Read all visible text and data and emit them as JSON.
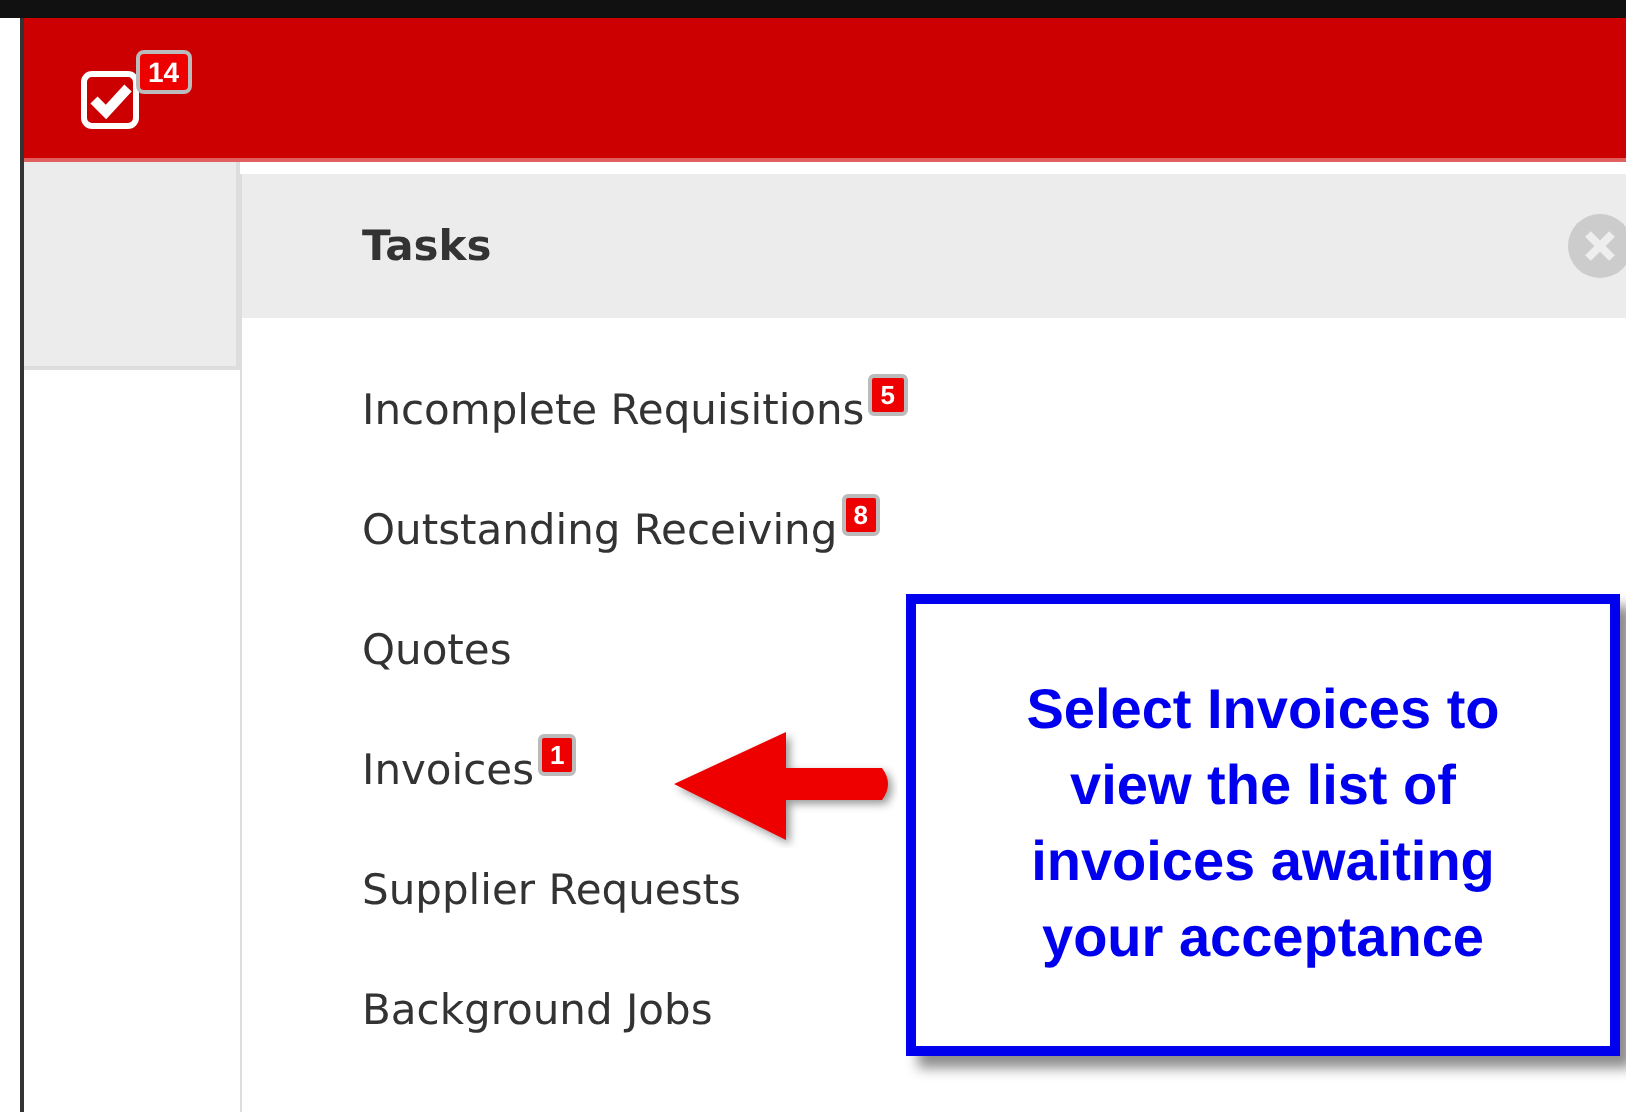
{
  "top_bar": {
    "tasks_badge": "14"
  },
  "tasks_panel": {
    "title": "Tasks",
    "items": [
      {
        "label": "Incomplete Requisitions",
        "badge": "5"
      },
      {
        "label": "Outstanding Receiving",
        "badge": "8"
      },
      {
        "label": "Quotes"
      },
      {
        "label": "Invoices",
        "badge": "1"
      },
      {
        "label": "Supplier Requests"
      },
      {
        "label": "Background Jobs"
      }
    ]
  },
  "callout": {
    "text": "Select Invoices to view the list of invoices awaiting your acceptance"
  }
}
